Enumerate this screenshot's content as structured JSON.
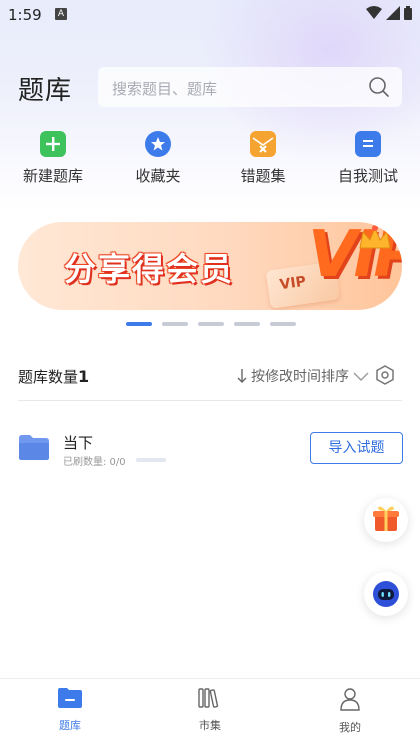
{
  "status_bar": {
    "time": "1:59",
    "notification_badge": "A"
  },
  "header": {
    "title": "题库",
    "search_placeholder": "搜索题目、题库"
  },
  "quick_actions": [
    {
      "label": "新建题库",
      "icon": "plus-square-icon",
      "color": "#3ec25b"
    },
    {
      "label": "收藏夹",
      "icon": "star-badge-icon",
      "color": "#3d7bea"
    },
    {
      "label": "错题集",
      "icon": "wrong-envelope-icon",
      "color": "#f5a331"
    },
    {
      "label": "自我测试",
      "icon": "test-sheet-icon",
      "color": "#3d7bea"
    }
  ],
  "banner": {
    "text": "分享得会员",
    "card_text": "VIP",
    "big_text": "VIP"
  },
  "carousel": {
    "count": 5,
    "active_index": 0
  },
  "list_header": {
    "count_label": "题库数量",
    "count_value": "1",
    "sort_label": "按修改时间排序"
  },
  "banks": [
    {
      "name": "当下",
      "progress_label": "已刷数量: 0/0",
      "progress": 0,
      "action_label": "导入试题"
    }
  ],
  "bottom_nav": [
    {
      "label": "题库",
      "icon": "folder-icon",
      "active": true
    },
    {
      "label": "市集",
      "icon": "books-icon",
      "active": false
    },
    {
      "label": "我的",
      "icon": "person-icon",
      "active": false
    }
  ],
  "colors": {
    "accent": "#3d7bea",
    "banner_orange": "#ff6a1e"
  }
}
